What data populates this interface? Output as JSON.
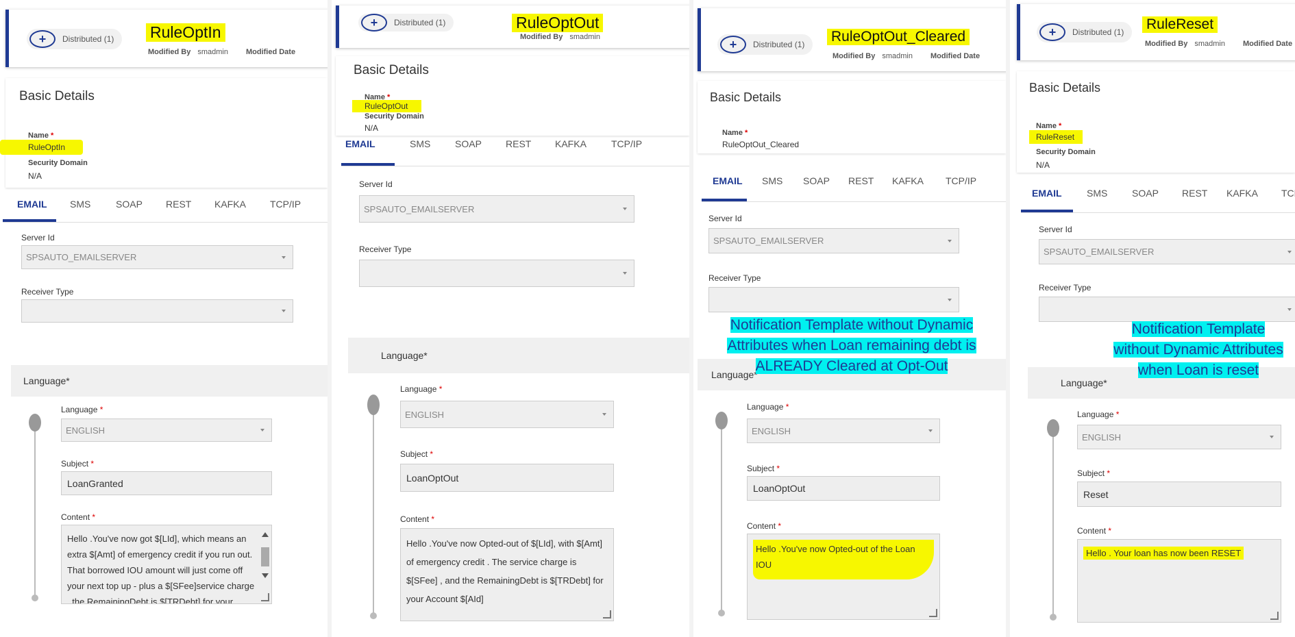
{
  "common": {
    "distributed": "Distributed (1)",
    "modified_by_label": "Modified By",
    "modified_by_value": "smadmin",
    "modified_date_label": "Modified Date",
    "basic_details": "Basic Details",
    "name_label": "Name",
    "required_mark": "*",
    "security_domain_label": "Security Domain",
    "security_domain_value": "N/A",
    "tabs": [
      "EMAIL",
      "SMS",
      "SOAP",
      "REST",
      "KAFKA",
      "TCP/IP"
    ],
    "server_id_label": "Server Id",
    "server_id_value": "SPSAUTO_EMAILSERVER",
    "receiver_type_label": "Receiver Type",
    "language_section": "Language*",
    "language_label": "Language",
    "language_value": "ENGLISH",
    "subject_label": "Subject",
    "content_label": "Content"
  },
  "panels": [
    {
      "title": "RuleOptIn",
      "name_value": "RuleOptIn",
      "subject": "LoanGranted",
      "content": "Hello .You've now got $[LId], which means an extra $[Amt] of emergency credit if you run out. That borrowed IOU amount will just come off your next top up - plus a $[SFee]service charge , the RemainingDebt is $[TRDebt] for your"
    },
    {
      "title": "RuleOptOut",
      "name_value": "RuleOptOut",
      "subject": "LoanOptOut",
      "content": "Hello .You've now Opted-out of  $[LId], with $[Amt] of emergency credit . The service charge is $[SFee] , and the RemainingDebt is $[TRDebt]  for your Account $[AId]"
    },
    {
      "title": "RuleOptOut_Cleared",
      "name_value": "RuleOptOut_Cleared",
      "subject": "LoanOptOut",
      "content": "Hello .You've now Opted-out of the Loan IOU",
      "note": "Notification Template without Dynamic Attributes when Loan remaining debt is ALREADY Cleared at Opt-Out"
    },
    {
      "title": "RuleReset",
      "name_value": "RuleReset",
      "subject": "Reset",
      "content": "Hello . Your loan has now been RESET",
      "note": "Notification Template without Dynamic Attributes when Loan is reset"
    }
  ],
  "colors": {
    "accent": "#1f3a93",
    "highlight": "#f7f700",
    "note_bg": "#00f0f0"
  }
}
